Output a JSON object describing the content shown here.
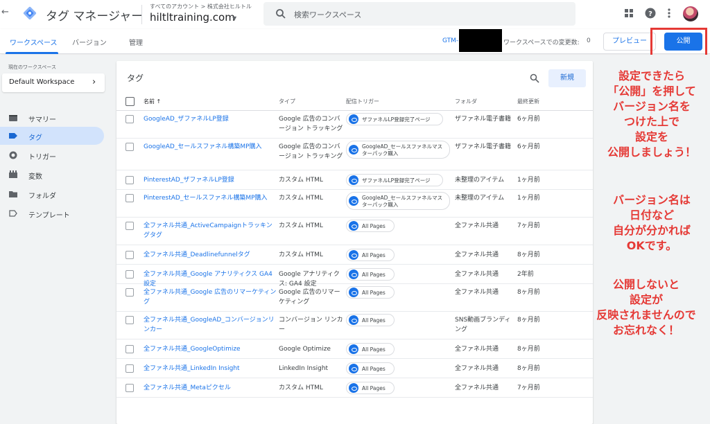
{
  "topbar": {
    "back_glyph": "←",
    "product_name": "タグ マネージャー",
    "account_label": "すべてのアカウント > 株式会社ヒルトル",
    "container_name": "hiltltraining.com",
    "search_placeholder": "検索ワークスペース"
  },
  "subnav": {
    "tabs": [
      "ワークスペース",
      "バージョン",
      "管理"
    ],
    "gtm_id": "GTM-",
    "changes_label": "ワークスペースでの変更数:",
    "changes_count": "0",
    "preview_label": "プレビュー",
    "publish_label": "公開"
  },
  "sidebar": {
    "workspace_label": "現在のワークスペース",
    "workspace_name": "Default Workspace",
    "items": [
      {
        "label": "サマリー",
        "icon": "summary-icon"
      },
      {
        "label": "タグ",
        "icon": "tag-icon",
        "active": true
      },
      {
        "label": "トリガー",
        "icon": "trigger-icon"
      },
      {
        "label": "変数",
        "icon": "variables-icon"
      },
      {
        "label": "フォルダ",
        "icon": "folder-icon"
      },
      {
        "label": "テンプレート",
        "icon": "template-icon"
      }
    ]
  },
  "tags": {
    "title": "タグ",
    "new_label": "新規",
    "headers": {
      "name": "名前 ↑",
      "type": "タイプ",
      "trigger": "配信トリガー",
      "folder": "フォルダ",
      "modified": "最終更新"
    },
    "rows": [
      {
        "name": "GoogleAD_ザファネルLP登録",
        "type": "Google 広告のコンバージョン トラッキング",
        "trigger": "ザファネルLP登録完了ページ",
        "folder": "ザファネル電子書籍",
        "modified": "6ヶ月前"
      },
      {
        "name": "GoogleAD_セールスファネル構築MP購入",
        "type": "Google 広告のコンバージョン トラッキング",
        "trigger": "GoogleAD_セールスファネルマスターパック購入",
        "folder": "ザファネル電子書籍",
        "modified": "6ヶ月前"
      },
      {
        "name": "PinterestAD_ザファネルLP登録",
        "type": "カスタム HTML",
        "trigger": "ザファネルLP登録完了ページ",
        "folder": "未整理のアイテム",
        "modified": "1ヶ月前"
      },
      {
        "name": "PinterestAD_セールスファネル構築MP購入",
        "type": "カスタム HTML",
        "trigger": "GoogleAD_セールスファネルマスターパック購入",
        "folder": "未整理のアイテム",
        "modified": "1ヶ月前"
      },
      {
        "name": "全ファネル共通_ActiveCampaignトラッキングタグ",
        "type": "カスタム HTML",
        "trigger": "All Pages",
        "folder": "全ファネル共通",
        "modified": "7ヶ月前"
      },
      {
        "name": "全ファネル共通_Deadlinefunnelタグ",
        "type": "カスタム HTML",
        "trigger": "All Pages",
        "folder": "全ファネル共通",
        "modified": "8ヶ月前"
      },
      {
        "name": "全ファネル共通_Google アナリティクス GA4 設定",
        "type": "Google アナリティクス: GA4 設定",
        "trigger": "All Pages",
        "folder": "全ファネル共通",
        "modified": "2年前"
      },
      {
        "name": "全ファネル共通_Google 広告のリマーケティング",
        "type": "Google 広告のリマーケティング",
        "trigger": "All Pages",
        "folder": "全ファネル共通",
        "modified": "8ヶ月前"
      },
      {
        "name": "全ファネル共通_GoogleAD_コンバージョンリンカー",
        "type": "コンバージョン リンカー",
        "trigger": "All Pages",
        "folder": "SNS動画ブランディング",
        "modified": "8ヶ月前"
      },
      {
        "name": "全ファネル共通_GoogleOptimize",
        "type": "Google Optimize",
        "trigger": "All Pages",
        "folder": "全ファネル共通",
        "modified": "8ヶ月前"
      },
      {
        "name": "全ファネル共通_LinkedIn Insight",
        "type": "LinkedIn Insight",
        "trigger": "All Pages",
        "folder": "全ファネル共通",
        "modified": "8ヶ月前"
      },
      {
        "name": "全ファネル共通_Metaピクセル",
        "type": "カスタム HTML",
        "trigger": "All Pages",
        "folder": "全ファネル共通",
        "modified": "7ヶ月前"
      }
    ]
  },
  "annotation": {
    "block1": [
      "設定できたら",
      "「公開」を押して",
      "バージョン名を",
      "つけた上で",
      "設定を",
      "公開しましょう！"
    ],
    "block2": [
      "バージョン名は",
      "日付など",
      "自分が分かれば",
      "OKです。"
    ],
    "block3": [
      "公開しないと",
      "設定が",
      "反映されませんので",
      "お忘れなく！"
    ]
  },
  "colors": {
    "accent": "#1a73e8",
    "annotation": "#e53935",
    "sidebar_active": "#d2e3fc"
  }
}
